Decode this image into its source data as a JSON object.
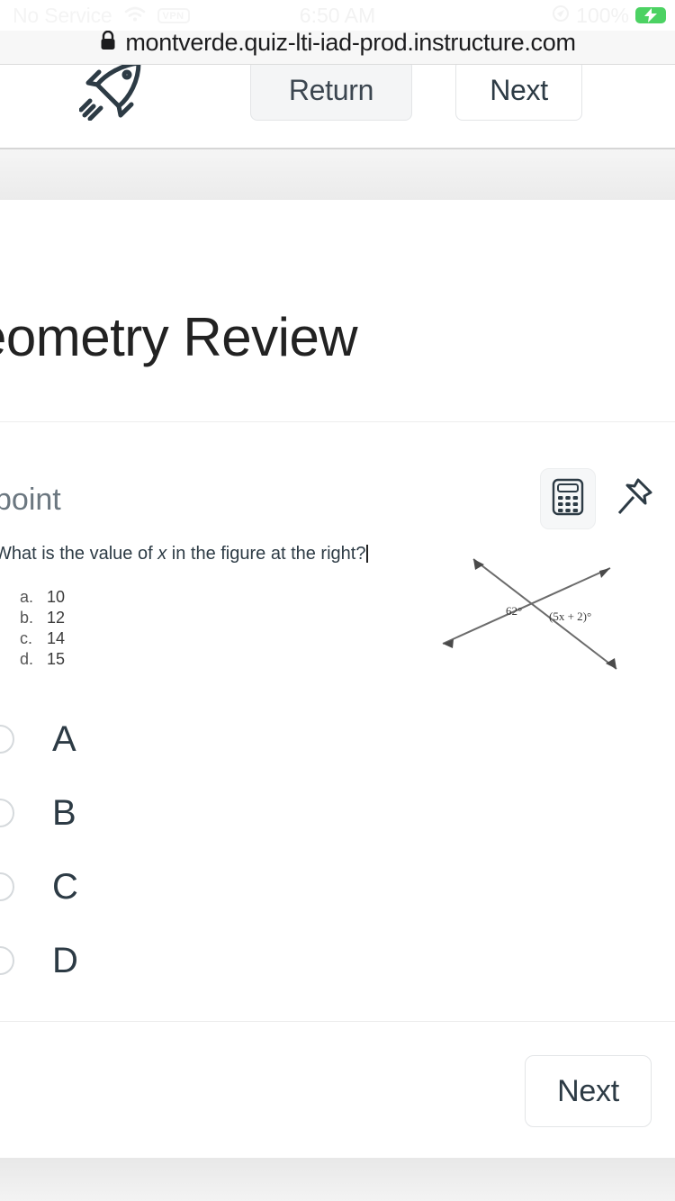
{
  "statusbar": {
    "carrier": "No Service",
    "vpn_badge": "VPN",
    "time": "6:50 AM",
    "battery_percent": "100%",
    "battery_color": "#4cd263",
    "wifi_icon": "wifi-icon",
    "battery_icon": "battery-charging-icon"
  },
  "browser": {
    "url": "montverde.quiz-lti-iad-prod.instructure.com",
    "lock_icon": "lock-icon"
  },
  "toolbar": {
    "rocket_icon": "rocket-icon",
    "return_label": "Return",
    "next_label": "Next"
  },
  "quiz": {
    "title": "eometry Review",
    "points_label": "point",
    "calculator_icon": "calculator-icon",
    "pin_icon": "pushpin-icon"
  },
  "question": {
    "prompt": "What is the value of x in the figure at the right?",
    "prompt_before_italic": "What is the value of ",
    "italic_var": "x",
    "prompt_after_italic": " in the figure at the right?",
    "embedded_options": [
      {
        "label": "a.",
        "value": "10"
      },
      {
        "label": "b.",
        "value": "12"
      },
      {
        "label": "c.",
        "value": "14"
      },
      {
        "label": "d.",
        "value": "15"
      }
    ],
    "figure": {
      "description": "two intersecting lines with arrowheads",
      "angle_left": "62°",
      "angle_right": "(5x + 2)°"
    }
  },
  "choices": [
    {
      "letter": "A"
    },
    {
      "letter": "B"
    },
    {
      "letter": "C"
    },
    {
      "letter": "D"
    }
  ],
  "footer": {
    "next_label": "Next"
  }
}
